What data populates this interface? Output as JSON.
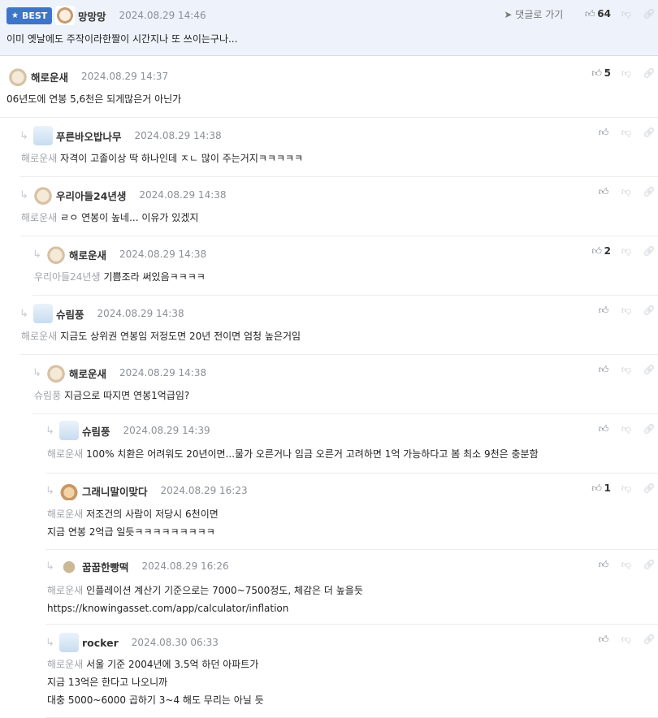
{
  "best": {
    "badge": "BEST",
    "nick": "망망망",
    "date": "2024.08.29 14:46",
    "goto_label": "댓글로 가기",
    "likes": "64",
    "body": "이미 옛날에도 주작이라한짤이 시간지나 또 쓰이는구나..."
  },
  "comments": [
    {
      "nick": "해로운새",
      "date": "2024.08.29 14:37",
      "mention": "",
      "lines": [
        "06년도에 연봉 5,6천은 되게많은거 아닌가"
      ],
      "likes": "5"
    },
    {
      "nick": "푸른바오밥나무",
      "date": "2024.08.29 14:38",
      "mention": "해로운새",
      "lines": [
        "자격이 고졸이상 딱 하나인데 ㅈㄴ 많이 주는거지ㅋㅋㅋㅋㅋ"
      ],
      "likes": ""
    },
    {
      "nick": "우리아들24년생",
      "date": "2024.08.29 14:38",
      "mention": "해로운새",
      "lines": [
        "ㄹㅇ 연봉이 높네... 이유가 있겠지"
      ],
      "likes": ""
    },
    {
      "nick": "해로운새",
      "date": "2024.08.29 14:38",
      "mention": "우리아들24년생",
      "lines": [
        "기쁨조라 써있음ㅋㅋㅋㅋ"
      ],
      "likes": "2"
    },
    {
      "nick": "슈림풍",
      "date": "2024.08.29 14:38",
      "mention": "해로운새",
      "lines": [
        "지금도 상위권 연봉임 저정도면 20년 전이면 엄청 높은거임"
      ],
      "likes": ""
    },
    {
      "nick": "해로운새",
      "date": "2024.08.29 14:38",
      "mention": "슈림풍",
      "lines": [
        "지금으로 따지면 연봉1억급임?"
      ],
      "likes": ""
    },
    {
      "nick": "슈림풍",
      "date": "2024.08.29 14:39",
      "mention": "해로운새",
      "lines": [
        "100% 치환은 어려워도 20년이면...물가 오른거나 임금 오른거 고려하면 1억 가능하다고 봄 최소 9천은 충분함"
      ],
      "likes": ""
    },
    {
      "nick": "그래니말이맞다",
      "date": "2024.08.29 16:23",
      "mention": "해로운새",
      "lines": [
        "저조건의 사람이 저당시 6천이면",
        "지금 연봉 2억급 일듯ㅋㅋㅋㅋㅋㅋㅋㅋㅋ"
      ],
      "likes": "1"
    },
    {
      "nick": "꿉꿉한빵떡",
      "date": "2024.08.29 16:26",
      "mention": "해로운새",
      "lines": [
        "인플레이션 계산기 기준으로는 7000~7500정도, 체감은 더 높을듯",
        "https://knowingasset.com/app/calculator/inflation"
      ],
      "likes": ""
    },
    {
      "nick": "rocker",
      "date": "2024.08.30 06:33",
      "mention": "해로운새",
      "lines": [
        "서울 기준 2004년에 3.5억 하던 아파트가",
        "지금 13억은 한다고 나오니까",
        "대충 5000~6000 곱하기 3~4 해도 무리는 아닐 듯"
      ],
      "likes": ""
    }
  ],
  "icons": {
    "like": "thumbs-up-icon",
    "dislike": "thumbs-down-icon",
    "link": "link-icon",
    "reply_arrow": "reply-arrow-icon",
    "star": "star-icon",
    "goto": "arrow-icon"
  },
  "colors": {
    "best_bg": "#eef3fb",
    "badge": "#3d75c9",
    "mention": "#a0a4aa",
    "date": "#8a8f96"
  }
}
